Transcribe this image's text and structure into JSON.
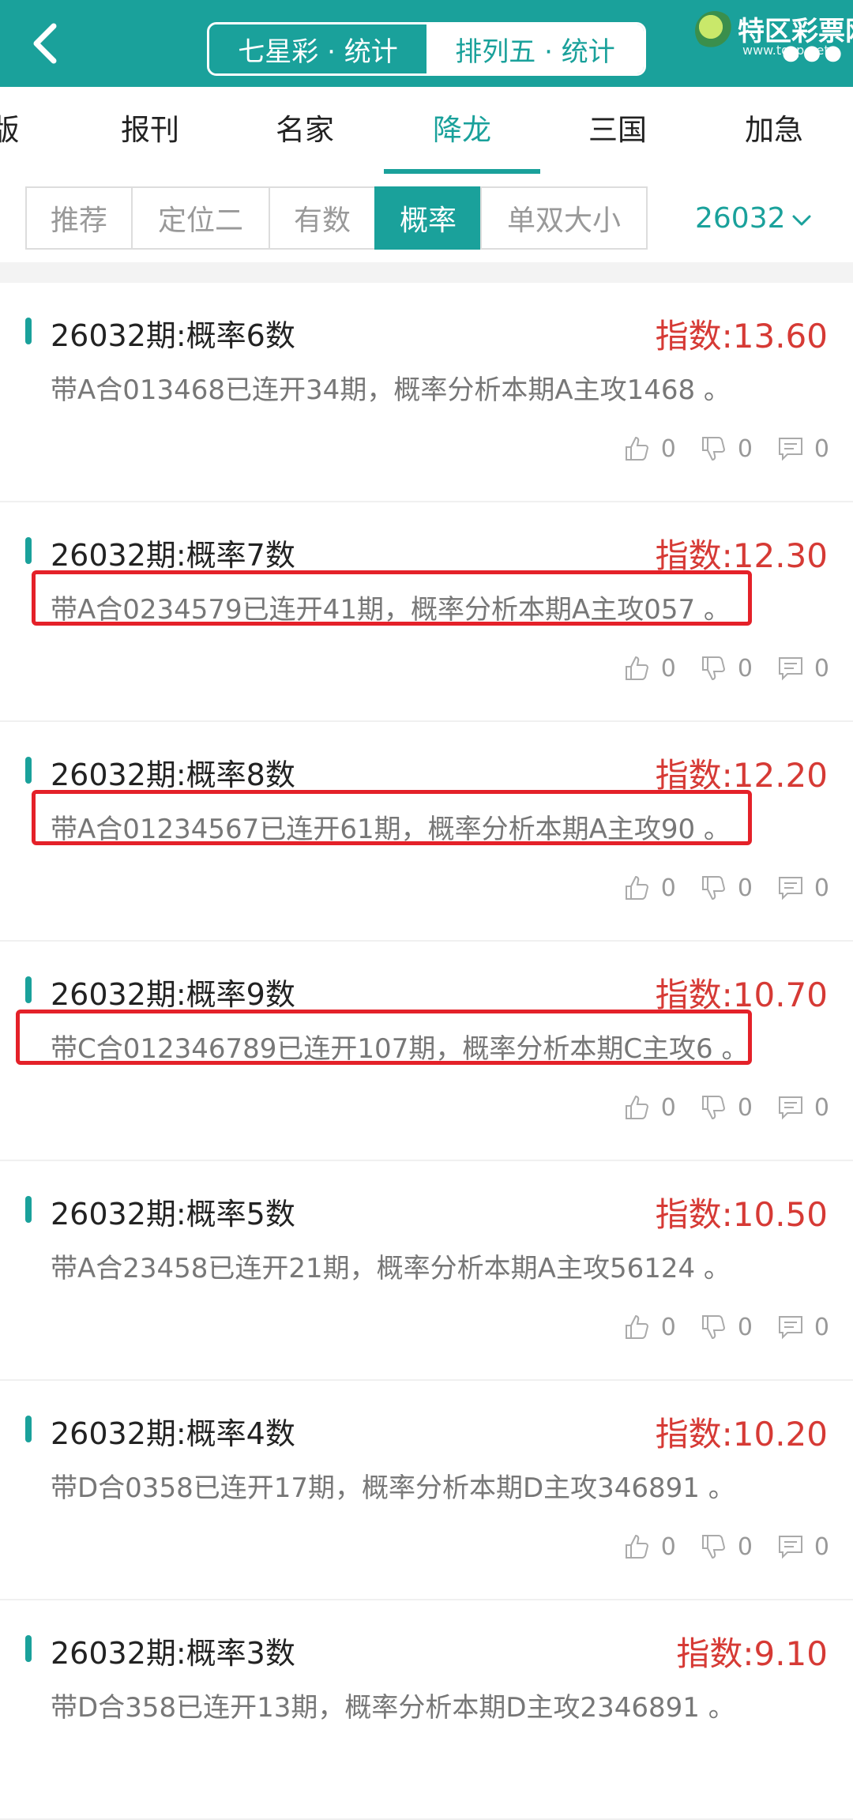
{
  "header": {
    "segments": [
      "七星彩 · 统计",
      "排列五 · 统计"
    ],
    "logo_text": "特区彩票网",
    "logo_url": "www.tqcp.net",
    "dots": "●●●"
  },
  "category_tabs": [
    "版",
    "报刊",
    "名家",
    "降龙",
    "三国",
    "加急"
  ],
  "sub_tabs": [
    "推荐",
    "定位二",
    "有数",
    "概率",
    "单双大小"
  ],
  "period": "26032",
  "items": [
    {
      "title": "26032期:概率6数",
      "index": "指数:13.60",
      "desc": "带A合013468已连开34期，概率分析本期A主攻1468 。",
      "up": "0",
      "down": "0",
      "comments": "0"
    },
    {
      "title": "26032期:概率7数",
      "index": "指数:12.30",
      "desc": "带A合0234579已连开41期，概率分析本期A主攻057 。",
      "up": "0",
      "down": "0",
      "comments": "0"
    },
    {
      "title": "26032期:概率8数",
      "index": "指数:12.20",
      "desc": "带A合01234567已连开61期，概率分析本期A主攻90 。",
      "up": "0",
      "down": "0",
      "comments": "0"
    },
    {
      "title": "26032期:概率9数",
      "index": "指数:10.70",
      "desc": "带C合012346789已连开107期，概率分析本期C主攻6 。",
      "up": "0",
      "down": "0",
      "comments": "0"
    },
    {
      "title": "26032期:概率5数",
      "index": "指数:10.50",
      "desc": "带A合23458已连开21期，概率分析本期A主攻56124 。",
      "up": "0",
      "down": "0",
      "comments": "0"
    },
    {
      "title": "26032期:概率4数",
      "index": "指数:10.20",
      "desc": "带D合0358已连开17期，概率分析本期D主攻346891 。",
      "up": "0",
      "down": "0",
      "comments": "0"
    },
    {
      "title": "26032期:概率3数",
      "index": "指数:9.10",
      "desc": "带D合358已连开13期，概率分析本期D主攻2346891 。",
      "up": "0",
      "down": "0",
      "comments": "0"
    }
  ]
}
